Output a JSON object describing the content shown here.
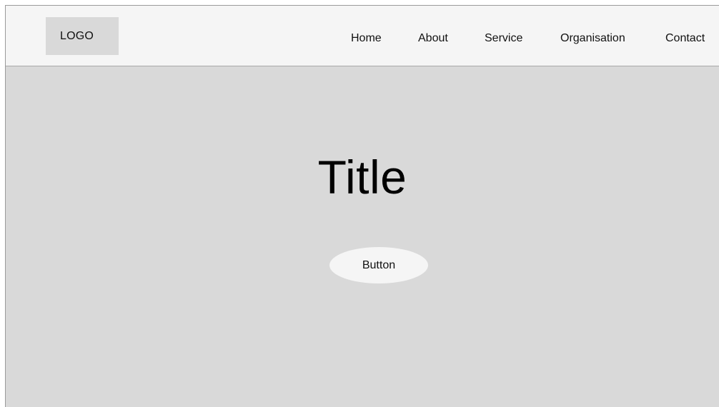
{
  "header": {
    "logo_text": "LOGO",
    "nav": [
      {
        "label": "Home"
      },
      {
        "label": "About"
      },
      {
        "label": "Service"
      },
      {
        "label": "Organisation"
      },
      {
        "label": "Contact"
      }
    ]
  },
  "hero": {
    "title": "Title",
    "button_label": "Button"
  },
  "colors": {
    "page_background": "#d9d9d9",
    "header_background": "#f5f5f5",
    "logo_background": "#d9d9d9",
    "button_background": "#f5f5f5",
    "text": "#111111"
  }
}
